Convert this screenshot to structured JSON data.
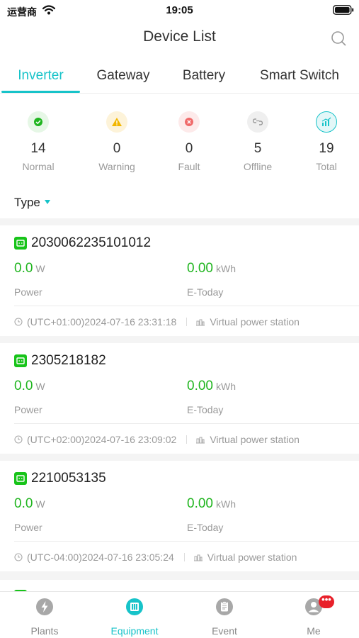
{
  "status_bar": {
    "carrier": "运营商",
    "time": "19:05"
  },
  "nav": {
    "title": "Device List"
  },
  "tabs": [
    {
      "label": "Inverter",
      "active": true
    },
    {
      "label": "Gateway",
      "active": false
    },
    {
      "label": "Battery",
      "active": false
    },
    {
      "label": "Smart Switch",
      "active": false
    }
  ],
  "stats": [
    {
      "count": "14",
      "label": "Normal",
      "icon": "check-icon",
      "color": "#1fb51f"
    },
    {
      "count": "0",
      "label": "Warning",
      "icon": "warning-icon",
      "color": "#f2b600"
    },
    {
      "count": "0",
      "label": "Fault",
      "icon": "fault-icon",
      "color": "#f06a6a"
    },
    {
      "count": "5",
      "label": "Offline",
      "icon": "offline-icon",
      "color": "#9a9a9a"
    },
    {
      "count": "19",
      "label": "Total",
      "icon": "chart-icon",
      "color": "#17c3c9"
    }
  ],
  "filter": {
    "type_label": "Type"
  },
  "devices": [
    {
      "serial": "2030062235101012",
      "power_value": "0.0",
      "power_unit": "W",
      "power_label": "Power",
      "energy_value": "0.00",
      "energy_unit": "kWh",
      "energy_label": "E-Today",
      "timestamp": "(UTC+01:00)2024-07-16 23:31:18",
      "station": "Virtual power station"
    },
    {
      "serial": "2305218182",
      "power_value": "0.0",
      "power_unit": "W",
      "power_label": "Power",
      "energy_value": "0.00",
      "energy_unit": "kWh",
      "energy_label": "E-Today",
      "timestamp": "(UTC+02:00)2024-07-16 23:09:02",
      "station": "Virtual power station"
    },
    {
      "serial": "2210053135",
      "power_value": "0.0",
      "power_unit": "W",
      "power_label": "Power",
      "energy_value": "0.00",
      "energy_unit": "kWh",
      "energy_label": "E-Today",
      "timestamp": "(UTC-04:00)2024-07-16 23:05:24",
      "station": "Virtual power station"
    }
  ],
  "bottom_nav": [
    {
      "label": "Plants",
      "icon": "bolt-icon",
      "active": false
    },
    {
      "label": "Equipment",
      "icon": "equipment-icon",
      "active": true
    },
    {
      "label": "Event",
      "icon": "clipboard-icon",
      "active": false
    },
    {
      "label": "Me",
      "icon": "user-icon",
      "active": false,
      "badge": "•••"
    }
  ],
  "colors": {
    "accent": "#17c3c9",
    "value_green": "#20b51f",
    "device_green": "#18c41a",
    "badge_red": "#e8202a"
  }
}
